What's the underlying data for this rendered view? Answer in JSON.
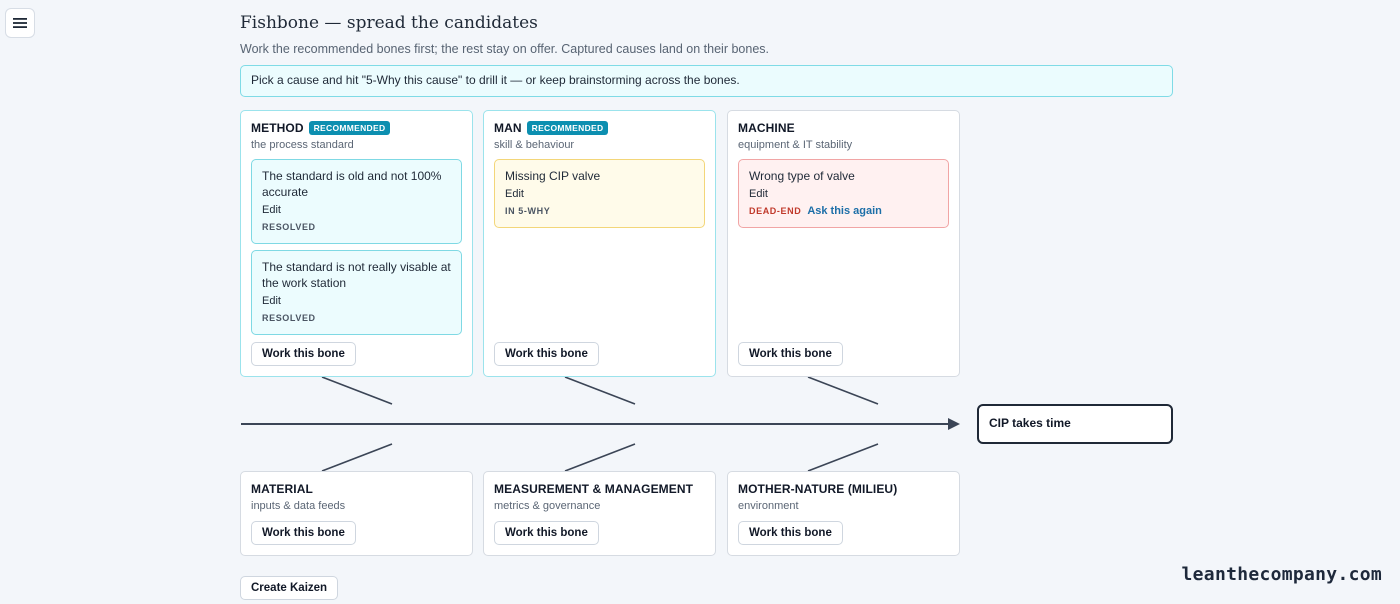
{
  "icons": {
    "menu": "hamburger-menu-icon",
    "arrow": "arrowhead-icon"
  },
  "header": {
    "title": "Fishbone — spread the candidates",
    "subtitle": "Work the recommended bones first; the rest stay on offer. Captured causes land on their bones."
  },
  "hint": "Pick a cause and hit \"5-Why this cause\" to drill it — or keep brainstorming across the bones.",
  "colors": {
    "recommended_badge": "#0c8fb0",
    "resolved_bg": "#ecfcfe",
    "in_why_bg": "#fffbea",
    "dead_end_bg": "#fff1f1",
    "dead_end_text": "#c0392b",
    "link": "#1d6fa8"
  },
  "bones": {
    "method": {
      "name": "METHOD",
      "badge": "RECOMMENDED",
      "subtitle": "the process standard",
      "causes": [
        {
          "text": "The standard is old and not 100% accurate",
          "edit": "Edit",
          "status": "RESOLVED"
        },
        {
          "text": "The standard is not really visable at the work station",
          "edit": "Edit",
          "status": "RESOLVED"
        }
      ],
      "button": "Work this bone"
    },
    "man": {
      "name": "MAN",
      "badge": "RECOMMENDED",
      "subtitle": "skill & behaviour",
      "causes": [
        {
          "text": "Missing CIP valve",
          "edit": "Edit",
          "status": "IN 5-WHY"
        }
      ],
      "button": "Work this bone"
    },
    "machine": {
      "name": "MACHINE",
      "subtitle": "equipment & IT stability",
      "causes": [
        {
          "text": "Wrong type of valve",
          "edit": "Edit",
          "status": "DEAD-END",
          "action": "Ask this again"
        }
      ],
      "button": "Work this bone"
    },
    "material": {
      "name": "MATERIAL",
      "subtitle": "inputs & data feeds",
      "button": "Work this bone"
    },
    "measurement": {
      "name": "MEASUREMENT & MANAGEMENT",
      "subtitle": "metrics & governance",
      "button": "Work this bone"
    },
    "mother_nature": {
      "name": "MOTHER-NATURE (MILIEU)",
      "subtitle": "environment",
      "button": "Work this bone"
    }
  },
  "effect": "CIP takes time",
  "create_kaizen": "Create Kaizen",
  "watermark": "leanthecompany.com"
}
